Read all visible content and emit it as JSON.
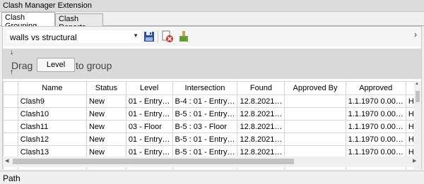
{
  "window": {
    "title": "Clash Manager Extension"
  },
  "tabs": [
    {
      "label": "Clash Grouping",
      "active": true
    },
    {
      "label": "Clash Reports",
      "active": false
    }
  ],
  "toolbar": {
    "test_select": {
      "value": "walls vs structural"
    },
    "icons": [
      "save-icon",
      "delete-report-icon",
      "clean-icon"
    ],
    "overflow_glyph": "›"
  },
  "group_area": {
    "drag_text_left": "Drag",
    "drag_text_right": "to group",
    "dragging_column": "Level",
    "up_glyph": "↑",
    "down_glyph": "↓"
  },
  "grid": {
    "columns": [
      "",
      "Name",
      "Status",
      "Level",
      "Intersection",
      "Found",
      "Approved By",
      "Approved",
      ""
    ],
    "rows": [
      {
        "name": "Clash9",
        "status": "New",
        "level": "01 - Entry…",
        "intersection": "B-4 : 01 - Entry…",
        "found": "12.8.2021…",
        "approved_by": "",
        "approved": "1.1.1970  0.00…",
        "extra": "Ha"
      },
      {
        "name": "Clash10",
        "status": "New",
        "level": "01 - Entry…",
        "intersection": "B-5 : 01 - Entry…",
        "found": "12.8.2021…",
        "approved_by": "",
        "approved": "1.1.1970  0.00…",
        "extra": "Ha"
      },
      {
        "name": "Clash11",
        "status": "New",
        "level": "03 - Floor",
        "intersection": "B-5 : 03 - Floor",
        "found": "12.8.2021…",
        "approved_by": "",
        "approved": "1.1.1970  0.00…",
        "extra": "Ha"
      },
      {
        "name": "Clash12",
        "status": "New",
        "level": "01 - Entry…",
        "intersection": "B-5 : 01 - Entry…",
        "found": "12.8.2021…",
        "approved_by": "",
        "approved": "1.1.1970  0.00…",
        "extra": "Ha"
      },
      {
        "name": "Clash13",
        "status": "New",
        "level": "01 - Entry…",
        "intersection": "B-5 : 01 - Entry…",
        "found": "12.8.2021…",
        "approved_by": "",
        "approved": "1.1.1970  0.00…",
        "extra": "Ha"
      }
    ]
  },
  "statusbar": {
    "text": "Path"
  },
  "colors": {
    "group_area_bg": "#d9d9d9",
    "save_icon": "#2b4fa0",
    "delete_icon": "#d03030",
    "clean_icon": "#6fa23a"
  }
}
